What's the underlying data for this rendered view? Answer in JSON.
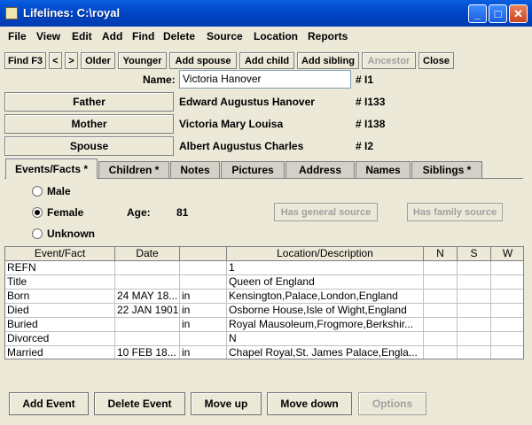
{
  "window": {
    "title": "Lifelines: C:\\royal",
    "controls": [
      "_",
      "□",
      "✕"
    ]
  },
  "menu": [
    "File",
    "View",
    "Edit",
    "Add",
    "Find",
    "Delete",
    "Source",
    "Location",
    "Reports"
  ],
  "toolbar": [
    "Find F3",
    "<",
    ">",
    "Older",
    "Younger",
    "Add spouse",
    "Add child",
    "Add sibling",
    "Ancestor",
    "Close"
  ],
  "person": {
    "name_label": "Name:",
    "name": "Victoria  Hanover",
    "id": "# I1",
    "father_label": "Father",
    "father": "Edward Augustus Hanover",
    "father_id": "# I133",
    "mother_label": "Mother",
    "mother": "Victoria Mary Louisa",
    "mother_id": "# I138",
    "spouse_label": "Spouse",
    "spouse": "Albert Augustus Charles",
    "spouse_id": "# I2"
  },
  "tabs": [
    "Events/Facts *",
    "Children *",
    "Notes",
    "Pictures",
    "Address",
    "Names",
    "Siblings *"
  ],
  "sex": {
    "male": "Male",
    "female": "Female",
    "unknown": "Unknown",
    "selected": "Female"
  },
  "age": {
    "label": "Age:",
    "value": "81"
  },
  "source_buttons": {
    "general": "Has general source",
    "family": "Has family source"
  },
  "table": {
    "columns": [
      "Event/Fact",
      "Date",
      "",
      "Location/Description",
      "N",
      "S",
      "W"
    ],
    "rows": [
      [
        "REFN",
        "",
        "",
        "1",
        "",
        "",
        ""
      ],
      [
        "Title",
        "",
        "",
        "Queen of England",
        "",
        "",
        ""
      ],
      [
        "Born",
        "24 MAY 18...",
        "in",
        "Kensington,Palace,London,England",
        "",
        "",
        ""
      ],
      [
        "Died",
        "22 JAN 1901",
        "in",
        "Osborne House,Isle of Wight,England",
        "",
        "",
        ""
      ],
      [
        "Buried",
        "",
        "in",
        "Royal Mausoleum,Frogmore,Berkshir...",
        "",
        "",
        ""
      ],
      [
        "Divorced",
        "",
        "",
        "N",
        "",
        "",
        ""
      ],
      [
        "Married",
        "10 FEB 18...",
        "in",
        "Chapel Royal,St. James Palace,Engla...",
        "",
        "",
        ""
      ]
    ]
  },
  "bottom_buttons": [
    "Add Event",
    "Delete Event",
    "Move up",
    "Move down",
    "Options"
  ]
}
